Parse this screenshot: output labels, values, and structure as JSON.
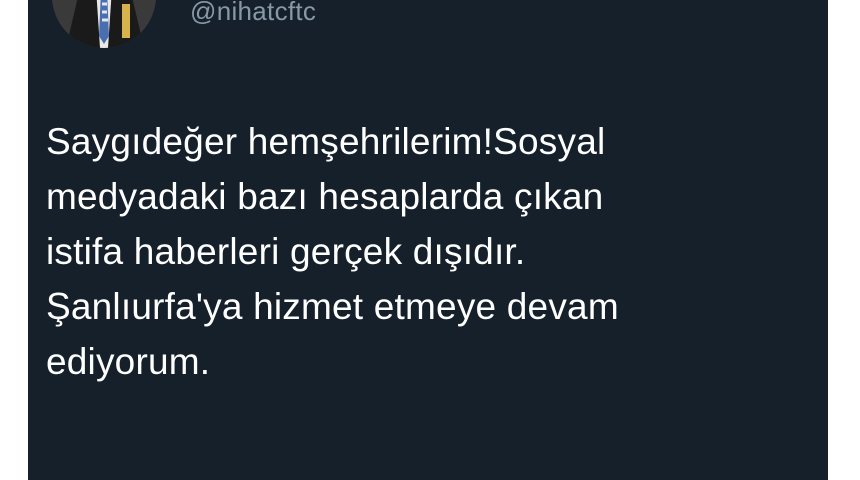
{
  "tweet": {
    "handle": "@nihatcftc",
    "avatar_icon": "profile-photo",
    "text_lines": [
      "Saygıdeğer hemşehrilerim!Sosyal",
      "medyadaki bazı hesaplarda çıkan",
      "istifa haberleri gerçek dışıdır.",
      "Şanlıurfa'ya hizmet etmeye devam",
      "ediyorum."
    ]
  },
  "colors": {
    "card_background": "#15202b",
    "text": "#ffffff",
    "handle": "#8899a6"
  }
}
